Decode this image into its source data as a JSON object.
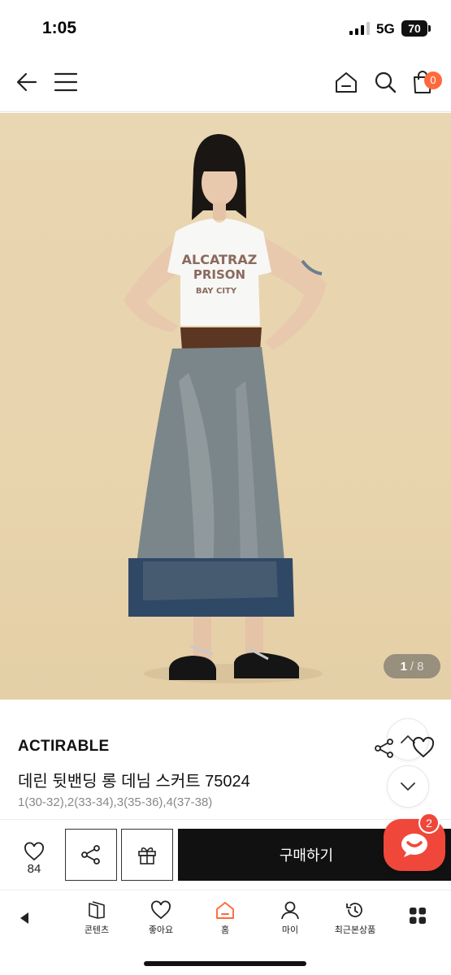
{
  "status": {
    "time": "1:05",
    "network": "5G",
    "battery": "70"
  },
  "nav": {
    "cart_count": "0"
  },
  "gallery": {
    "current": "1",
    "separator": "/",
    "total": "8"
  },
  "product": {
    "brand": "ACTIRABLE",
    "title": "데린 뒷밴딩 롱 데님 스커트 75024",
    "options": "1(30-32),2(33-34),3(35-36),4(37-38)"
  },
  "actions": {
    "like_count": "84",
    "buy_label": "구매하기",
    "chat_badge": "2"
  },
  "tabs": [
    {
      "label": "콘텐츠",
      "icon": "book-icon"
    },
    {
      "label": "좋아요",
      "icon": "heart-icon"
    },
    {
      "label": "홈",
      "icon": "home-icon"
    },
    {
      "label": "마이",
      "icon": "user-icon"
    },
    {
      "label": "최근본상품",
      "icon": "history-icon"
    }
  ],
  "colors": {
    "accent": "#ff6a3c",
    "chat": "#f0473b",
    "buy_bg": "#111111"
  }
}
